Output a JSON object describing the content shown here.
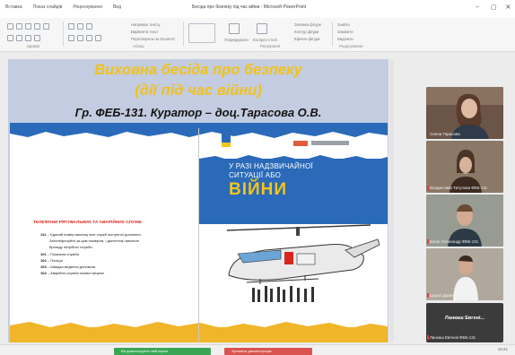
{
  "app": {
    "title": "Бесіда про безпеку під час війни  -  Microsoft PowerPoint",
    "menu": [
      "Вставка",
      "Показ слайдів",
      "Рецензування",
      "Вид"
    ],
    "controls": {
      "minimize": "–",
      "maximize": "▢",
      "close": "×"
    }
  },
  "ribbon": {
    "groups": [
      {
        "label": "Шрифт"
      },
      {
        "label": "Абзац"
      },
      {
        "label": "Рисування"
      },
      {
        "label": "Редагування"
      }
    ],
    "items": [
      "Напрямок тексту",
      "Вирівняти текст",
      "Перетворити на SmartArt",
      "Упорядкувати",
      "Експрес-стилі",
      "Заливка фігури",
      "Контур фігури",
      "Ефекти фігури",
      "Знайти",
      "Замінити",
      "Виділити"
    ]
  },
  "slide": {
    "title_line1": "Виховна бесіда про безпеку",
    "title_line2": "(дії під час війни)",
    "subtitle": "Гр. ФЕБ-131. Куратор – доц.Тарасова О.В.",
    "leaflet": {
      "banner_line1": "У РАЗІ НАДЗВИЧАЙНОЇ",
      "banner_line2": "СИТУАЦІЇ АБО",
      "banner_word": "ВІЙНИ",
      "phones_heading": "ТЕЛЕФОНИ РЯТУВАЛЬНИХ ТА АВАРІЙНИХ СЛУЖБ",
      "phones": [
        {
          "num": "112",
          "text": "– Єдиний номер виклику всіх служб екстреної допомоги."
        },
        {
          "num": "",
          "text": "Зателефонуйте за цим номером, і диспетчер викличе"
        },
        {
          "num": "",
          "text": "бригаду потрібної служби."
        },
        {
          "num": "101",
          "text": "– Пожежна служба"
        },
        {
          "num": "102",
          "text": "– Поліція"
        },
        {
          "num": "103",
          "text": "– Швидка медична допомога"
        },
        {
          "num": "104",
          "text": "– Аварійна служба газової мережі"
        }
      ]
    }
  },
  "participants": [
    {
      "name": "Олена Тарасова",
      "muted": false,
      "bg": "#6b5448"
    },
    {
      "name": "Владислава Титулова ФЕБ-131",
      "muted": true,
      "bg": "#7b6a5a"
    },
    {
      "name": "Біляр Олександр ФЕБ-131",
      "muted": true,
      "bg": "#5d6a63"
    },
    {
      "name": "Цорах Дарина ФЕБ-131",
      "muted": true,
      "bg": "#8c8074"
    },
    {
      "name": "Ланкаш Евгенія ФЕБ-131",
      "muted": true,
      "bg": "#3b3b3b",
      "center_label": "Ланкаш Евгені..."
    }
  ],
  "bottombar": {
    "green_label": "Ви демонструєте свій екран",
    "red_label": "Зупинити демонстрацію",
    "status": "15:21"
  }
}
